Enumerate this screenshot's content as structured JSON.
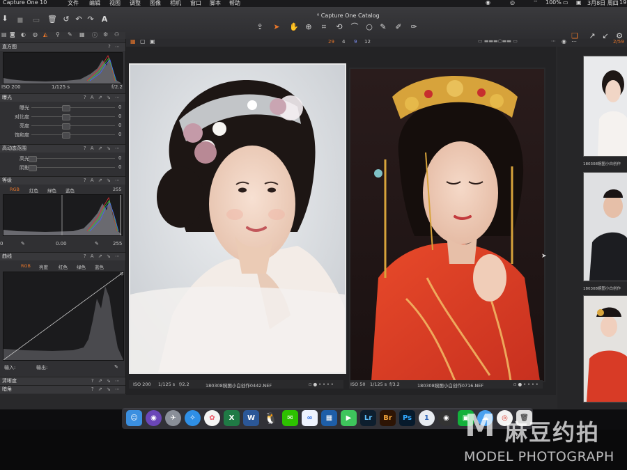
{
  "menubar": {
    "app": "Capture One 10",
    "items": [
      "文件",
      "编辑",
      "视图",
      "调整",
      "图像",
      "相机",
      "窗口",
      "脚本",
      "帮助"
    ],
    "battery": "100%",
    "date": "3月8日 周四",
    "clock": "19:"
  },
  "window": {
    "title": "Capture One Catalog"
  },
  "toolbar": {
    "counts": [
      "29",
      "4",
      "9",
      "12"
    ],
    "filmstrip_count": "2/59"
  },
  "tools": {
    "histogram": {
      "title": "直方图",
      "iso": "ISO 200",
      "shutter": "1/125 s",
      "aperture": "f/2.2"
    },
    "exposure": {
      "title": "曝光",
      "rows": [
        {
          "label": "曝光",
          "value": "0"
        },
        {
          "label": "对比度",
          "value": "0"
        },
        {
          "label": "亮度",
          "value": "0"
        },
        {
          "label": "饱和度",
          "value": "0"
        }
      ]
    },
    "hdr": {
      "title": "高动态范围",
      "rows": [
        {
          "label": "高光",
          "value": "0"
        },
        {
          "label": "阴影",
          "value": "0"
        }
      ]
    },
    "levels": {
      "title": "等级",
      "tabs": [
        "RGB",
        "红色",
        "绿色",
        "蓝色"
      ],
      "max": "255",
      "min": "0",
      "mid": "0.00",
      "out_max": "255"
    },
    "curve": {
      "title": "曲线",
      "tabs": [
        "RGB",
        "亮度",
        "红色",
        "绿色",
        "蓝色"
      ],
      "input_label": "输入:",
      "output_label": "输出:"
    },
    "clarity": {
      "title": "清晰度"
    },
    "vignette": {
      "title": "暗角"
    }
  },
  "viewer": {
    "photos": [
      {
        "iso": "ISO 200",
        "shutter": "1/125 s",
        "aperture": "f/2.2",
        "filename": "180308婉图小白创作0442.NEF",
        "dots": "▫ ● • • • •"
      },
      {
        "iso": "ISO 50",
        "shutter": "1/125 s",
        "aperture": "f/3.2",
        "filename": "180308婉图小白创作0716.NEF",
        "dots": "▫ ● • • • •"
      }
    ]
  },
  "filmstrip": {
    "captions": [
      "180308婉图小白创作",
      "180308婉图小白创作",
      ""
    ]
  },
  "dock": {
    "apps": [
      "Finder",
      "Siri",
      "Launchpad",
      "Safari",
      "Photos",
      "Excel",
      "Word",
      "QQ",
      "WeChat",
      "Baidu",
      "Calc",
      "FaceTime",
      "Lr",
      "Br",
      "Ps",
      "1",
      "Media",
      "iQIYI",
      "Chrome",
      "Preview",
      "Trash"
    ],
    "labels": {
      "excel": "X",
      "word": "W",
      "lr": "Lr",
      "br": "Br",
      "ps": "Ps",
      "one": "1"
    }
  },
  "watermark": {
    "cn": "麻豆约拍",
    "en": "MODEL PHOTOGRAPH"
  },
  "colors": {
    "accent_orange": "#e8762a",
    "selection_border": "#e8e8e8"
  }
}
